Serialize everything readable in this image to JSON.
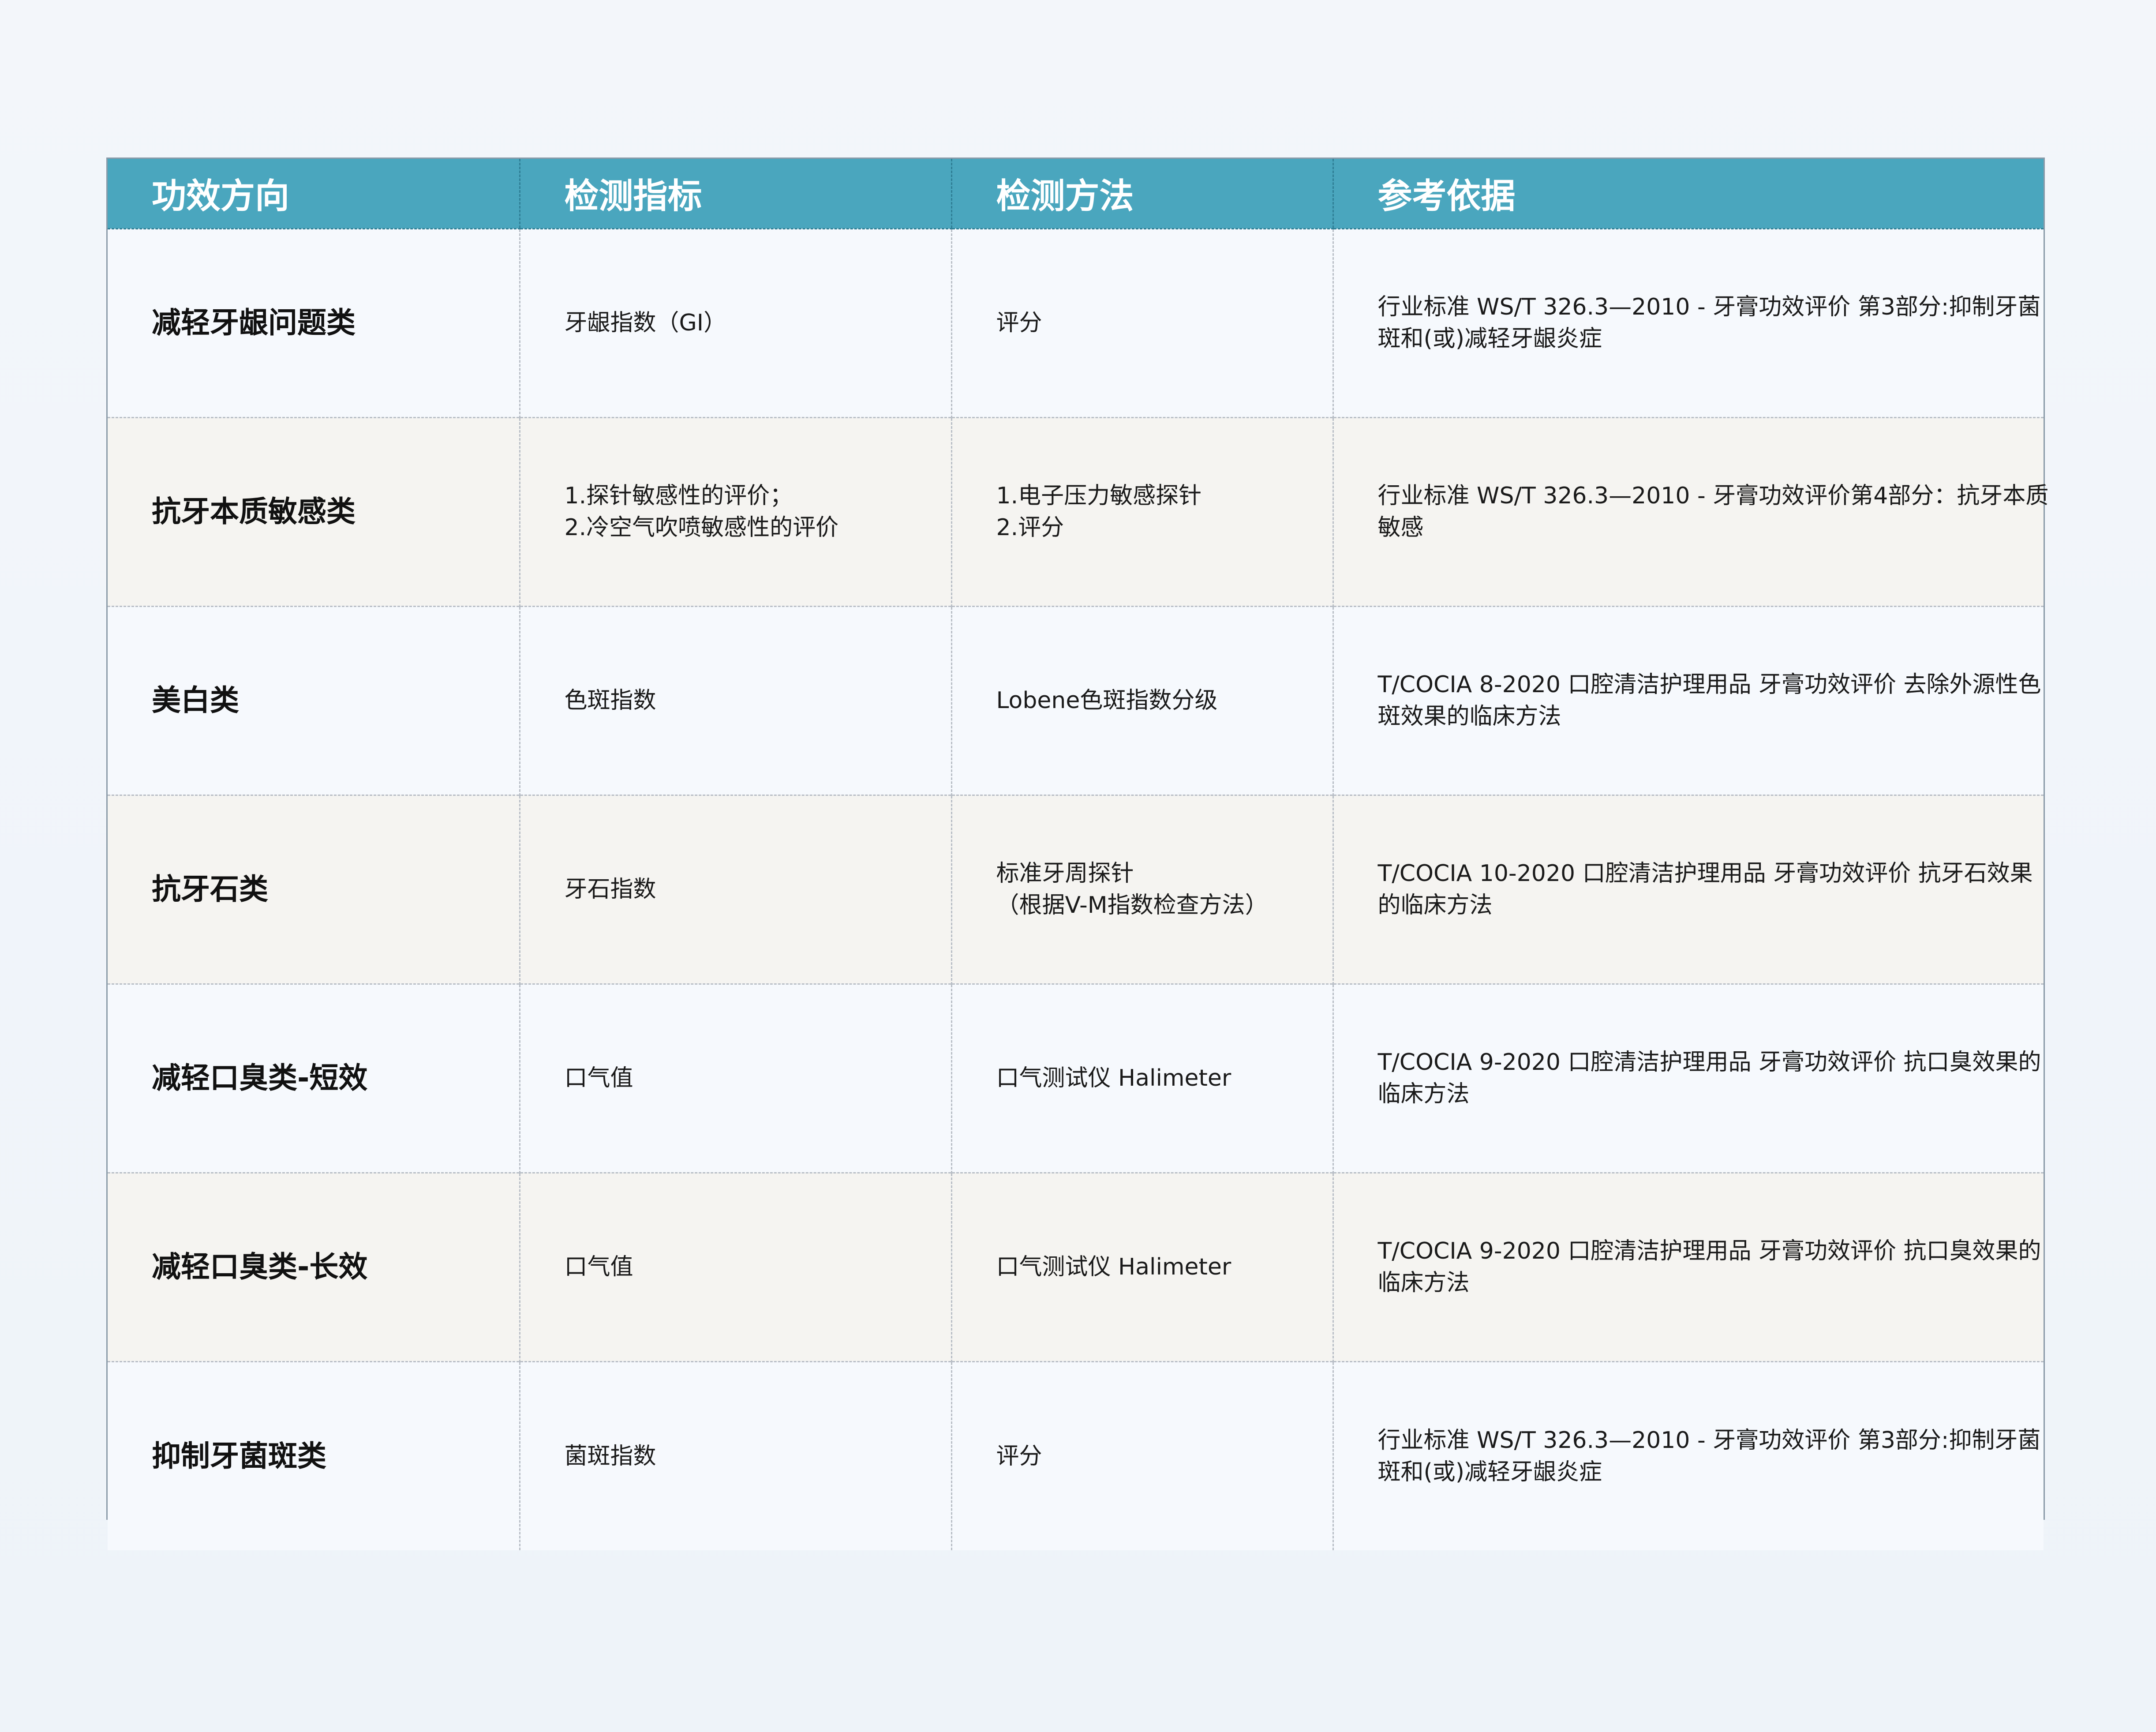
{
  "table": {
    "headers": [
      "功效方向",
      "检测指标",
      "检测方法",
      "参考依据"
    ],
    "rows": [
      {
        "direction": "减轻牙龈问题类",
        "indicator": [
          "牙龈指数（GI）"
        ],
        "method": [
          "评分"
        ],
        "reference": [
          "行业标准 WS/T 326.3—2010 - 牙膏功效评价 第3部分:抑制牙菌",
          "斑和(或)减轻牙龈炎症"
        ]
      },
      {
        "direction": "抗牙本质敏感类",
        "indicator": [
          "1.探针敏感性的评价；",
          "2.冷空气吹喷敏感性的评价"
        ],
        "method": [
          "1.电子压力敏感探针",
          "2.评分"
        ],
        "reference": [
          "行业标准 WS/T 326.3—2010 - 牙膏功效评价第4部分：抗牙本质",
          "敏感"
        ]
      },
      {
        "direction": "美白类",
        "indicator": [
          "色斑指数"
        ],
        "method": [
          "Lobene色斑指数分级"
        ],
        "reference": [
          "T/COCIA 8-2020 口腔清洁护理用品 牙膏功效评价 去除外源性色",
          "斑效果的临床方法"
        ]
      },
      {
        "direction": "抗牙石类",
        "indicator": [
          "牙石指数"
        ],
        "method": [
          "标准牙周探针",
          "（根据V-M指数检查方法）"
        ],
        "reference": [
          "T/COCIA 10-2020 口腔清洁护理用品 牙膏功效评价 抗牙石效果",
          "的临床方法"
        ]
      },
      {
        "direction": "减轻口臭类-短效",
        "indicator": [
          "口气值"
        ],
        "method": [
          "口气测试仪 Halimeter"
        ],
        "reference": [
          "T/COCIA 9-2020 口腔清洁护理用品 牙膏功效评价 抗口臭效果的",
          "临床方法"
        ]
      },
      {
        "direction": "减轻口臭类-长效",
        "indicator": [
          "口气值"
        ],
        "method": [
          "口气测试仪 Halimeter"
        ],
        "reference": [
          "T/COCIA 9-2020 口腔清洁护理用品 牙膏功效评价 抗口臭效果的",
          "临床方法"
        ]
      },
      {
        "direction": "抑制牙菌斑类",
        "indicator": [
          "菌斑指数"
        ],
        "method": [
          "评分"
        ],
        "reference": [
          "行业标准 WS/T 326.3—2010 - 牙膏功效评价 第3部分:抑制牙菌",
          "斑和(或)减轻牙龈炎症"
        ]
      }
    ]
  },
  "colors": {
    "header_bg": "#4aa6be",
    "row_alt_bg": "#f5f4f1",
    "row_bg": "#f6f9fd"
  }
}
